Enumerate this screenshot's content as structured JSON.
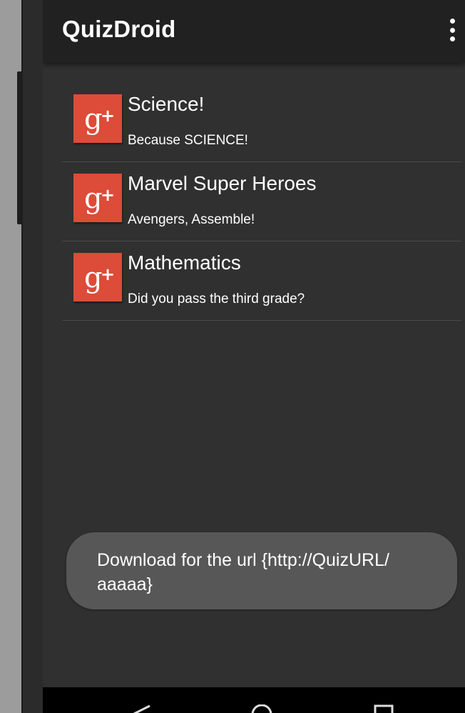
{
  "app": {
    "title": "QuizDroid"
  },
  "quizzes": [
    {
      "title": "Science!",
      "description": "Because SCIENCE!",
      "icon": "google-plus-icon"
    },
    {
      "title": "Marvel Super Heroes",
      "description": "Avengers, Assemble!",
      "icon": "google-plus-icon"
    },
    {
      "title": "Mathematics",
      "description": "Did you pass the third grade?",
      "icon": "google-plus-icon"
    }
  ],
  "toast": {
    "message": "Download for the url {http://QuizURL/ aaaaa}"
  },
  "icons": {
    "menu": "more-vert-icon",
    "nav_back": "back-icon",
    "nav_home": "home-icon",
    "nav_recents": "recents-icon"
  },
  "colors": {
    "app_bar": "#212121",
    "background": "#303030",
    "icon_red": "#dd4b39",
    "toast": "#575757"
  }
}
